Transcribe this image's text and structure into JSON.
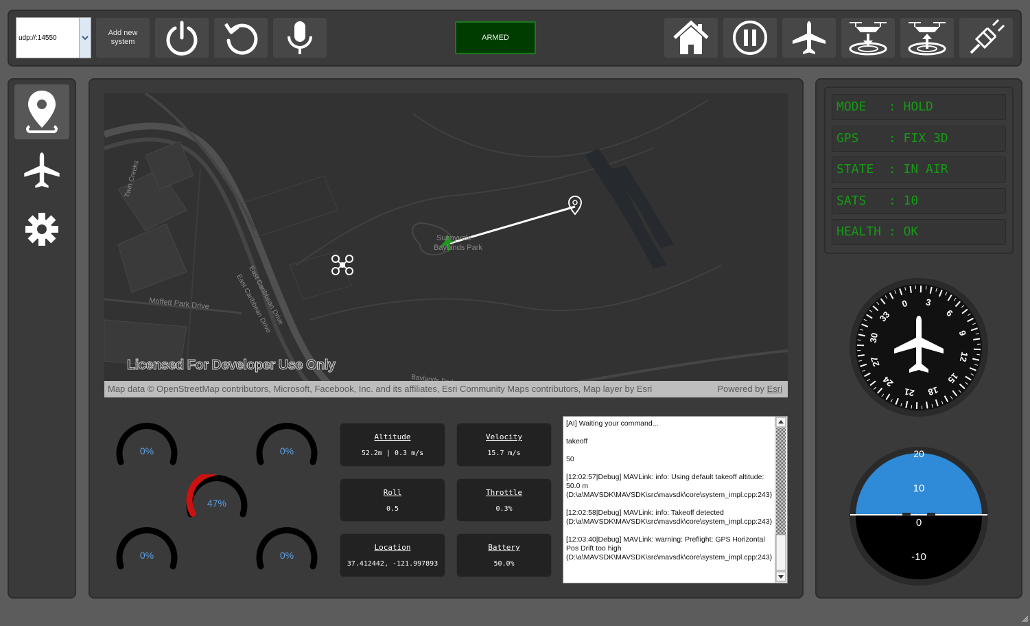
{
  "toolbar": {
    "connection_value": "udp://:14550",
    "add_system_label_line1": "Add new",
    "add_system_label_line2": "system",
    "armed_label": "ARMED"
  },
  "map": {
    "park_label_line1": "Sunnyvale",
    "park_label_line2": "Baylands Park",
    "street_twin_creeks": "Twin Creeks",
    "street_east_caribbean": "East Caribbean Drive",
    "street_moffett": "Moffett Park Drive",
    "street_baylands": "Baylands Park",
    "licensed_text": "Licensed For Developer Use Only",
    "attribution": "Map data © OpenStreetMap contributors, Microsoft, Facebook, Inc. and its affiliates, Esri Community Maps contributors, Map layer by Esri",
    "powered_by": "Powered by",
    "powered_link": "Esri"
  },
  "motors": {
    "m1": "0%",
    "m2": "0%",
    "m3": "47%",
    "m4": "0%",
    "m5": "0%",
    "m3_fraction": 0.47,
    "active_color": "#cc1111"
  },
  "telemetry": {
    "altitude_label": "Altitude",
    "altitude_value": "52.2m | 0.3 m/s",
    "velocity_label": "Velocity",
    "velocity_value": "15.7 m/s",
    "roll_label": "Roll",
    "roll_value": "0.5",
    "throttle_label": "Throttle",
    "throttle_value": "0.3%",
    "location_label": "Location",
    "location_value": "37.412442, -121.997893",
    "battery_label": "Battery",
    "battery_value": "50.0%"
  },
  "log": {
    "text": "[AI] Waiting your command...\n\ntakeoff\n\n50\n\n[12:02:57|Debug] MAVLink: info: Using default takeoff altitude: 50.0 m  (D:\\a\\MAVSDK\\MAVSDK\\src\\mavsdk\\core\\system_impl.cpp:243)\n\n[12:02:58|Debug] MAVLink: info: Takeoff detected  (D:\\a\\MAVSDK\\MAVSDK\\src\\mavsdk\\core\\system_impl.cpp:243)\n\n[12:03:40|Debug] MAVLink: warning: Preflight: GPS Horizontal Pos Drift too high (D:\\a\\MAVSDK\\MAVSDK\\src\\mavsdk\\core\\system_impl.cpp:243)"
  },
  "status": {
    "mode": "MODE   : HOLD",
    "gps": "GPS    : FIX 3D",
    "state": "STATE  : IN AIR",
    "sats": "SATS   : 10",
    "health": "HEALTH : OK",
    "text_color": "#149b14"
  },
  "compass": {
    "labels": [
      "0",
      "3",
      "6",
      "9",
      "12",
      "15",
      "18",
      "21",
      "24",
      "27",
      "30",
      "33"
    ]
  },
  "attitude": {
    "label_20": "20",
    "label_10": "10",
    "label_0": "0",
    "label_m10": "-10",
    "sky_color": "#2f8ad8",
    "ground_color": "#000000"
  }
}
